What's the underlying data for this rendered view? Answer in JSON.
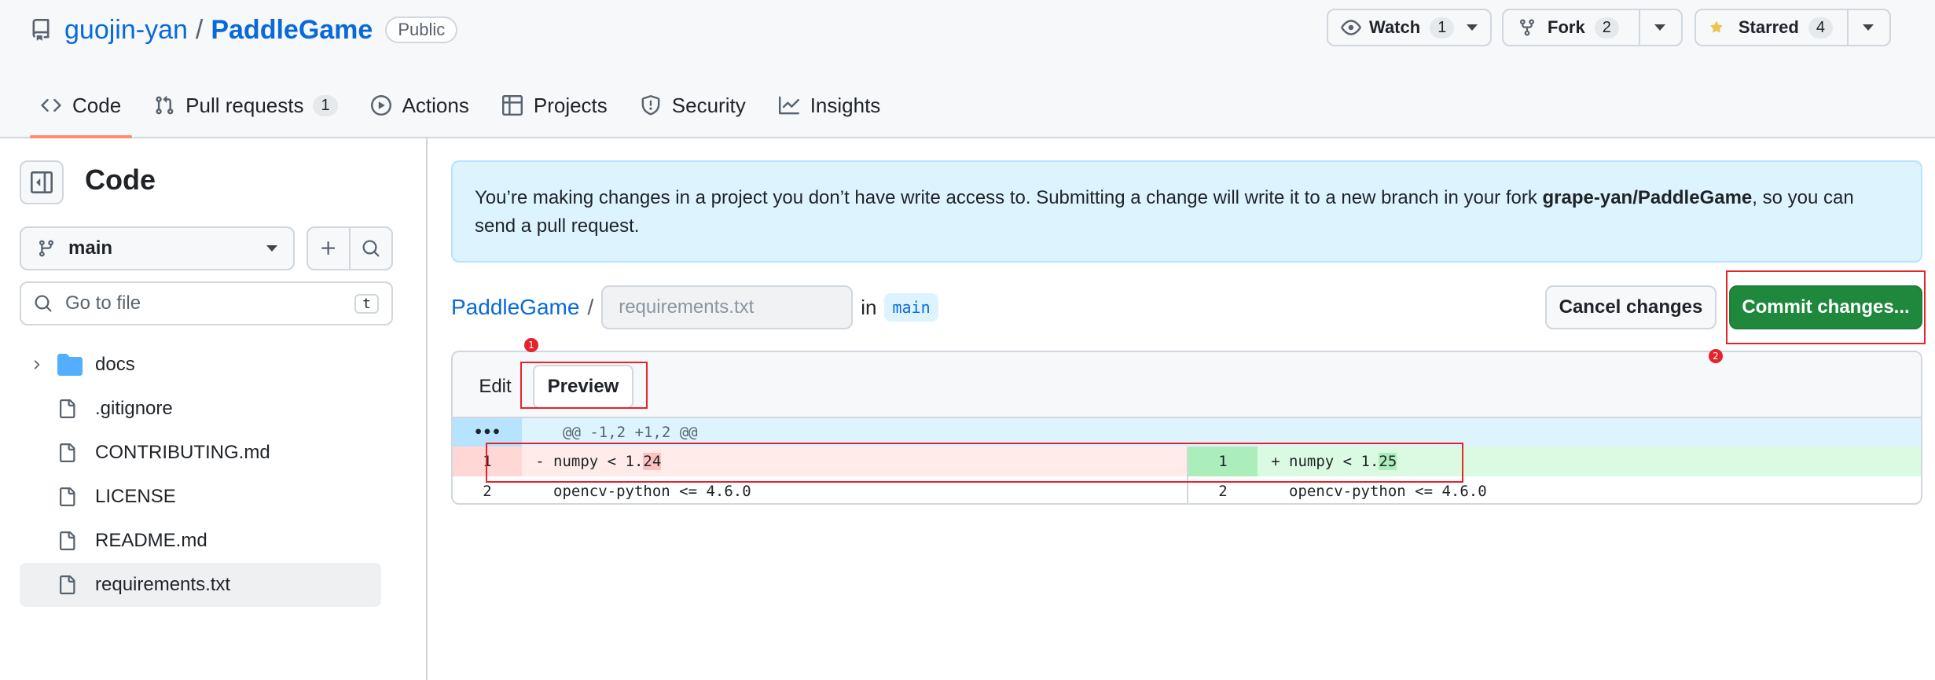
{
  "repo": {
    "owner": "guojin-yan",
    "separator": "/",
    "name": "PaddleGame",
    "visibility": "Public"
  },
  "header_buttons": {
    "watch_label": "Watch",
    "watch_count": "1",
    "fork_label": "Fork",
    "fork_count": "2",
    "star_label": "Starred",
    "star_count": "4"
  },
  "tabs": [
    {
      "label": "Code",
      "icon": "code-icon",
      "selected": true
    },
    {
      "label": "Pull requests",
      "icon": "pull-request-icon",
      "count": "1"
    },
    {
      "label": "Actions",
      "icon": "play-icon"
    },
    {
      "label": "Projects",
      "icon": "table-icon"
    },
    {
      "label": "Security",
      "icon": "shield-icon"
    },
    {
      "label": "Insights",
      "icon": "graph-icon"
    }
  ],
  "sidebar": {
    "title": "Code",
    "branch": "main",
    "goto_placeholder": "Go to file",
    "goto_shortcut": "t",
    "tree": [
      {
        "label": "docs",
        "type": "folder"
      },
      {
        "label": ".gitignore",
        "type": "file"
      },
      {
        "label": "CONTRIBUTING.md",
        "type": "file"
      },
      {
        "label": "LICENSE",
        "type": "file"
      },
      {
        "label": "README.md",
        "type": "file"
      },
      {
        "label": "requirements.txt",
        "type": "file",
        "selected": true
      }
    ]
  },
  "notice": {
    "text_before": "You’re making changes in a project you don’t have write access to. Submitting a change will write it to a new branch in your fork ",
    "fork_name": "grape-yan/PaddleGame",
    "text_after": ", so you can send a pull request."
  },
  "path": {
    "repo_link": "PaddleGame",
    "slash": "/",
    "filename_placeholder": "requirements.txt",
    "in_label": "in",
    "branch": "main"
  },
  "actions": {
    "cancel_label": "Cancel changes",
    "commit_label": "Commit changes..."
  },
  "editor": {
    "edit_tab": "Edit",
    "preview_tab": "Preview",
    "hunk_expand": "•••",
    "hunk_header": "@@ -1,2 +1,2 @@",
    "rows": [
      {
        "left_num": "1",
        "left_sign": "-",
        "left_prefix": "numpy < 1.",
        "left_hl": "24",
        "right_num": "1",
        "right_sign": "+",
        "right_prefix": "numpy < 1.",
        "right_hl": "25"
      },
      {
        "left_num": "2",
        "left_code": "opencv-python <= 4.6.0",
        "right_num": "2",
        "right_code": "opencv-python <= 4.6.0"
      }
    ]
  },
  "annotations": {
    "marker_1": "1",
    "marker_2": "2"
  },
  "colors": {
    "accent_blue": "#0969da",
    "commit_green": "#1f883d",
    "tab_underline": "#fd8c73",
    "annotation_red": "#e5232a"
  }
}
